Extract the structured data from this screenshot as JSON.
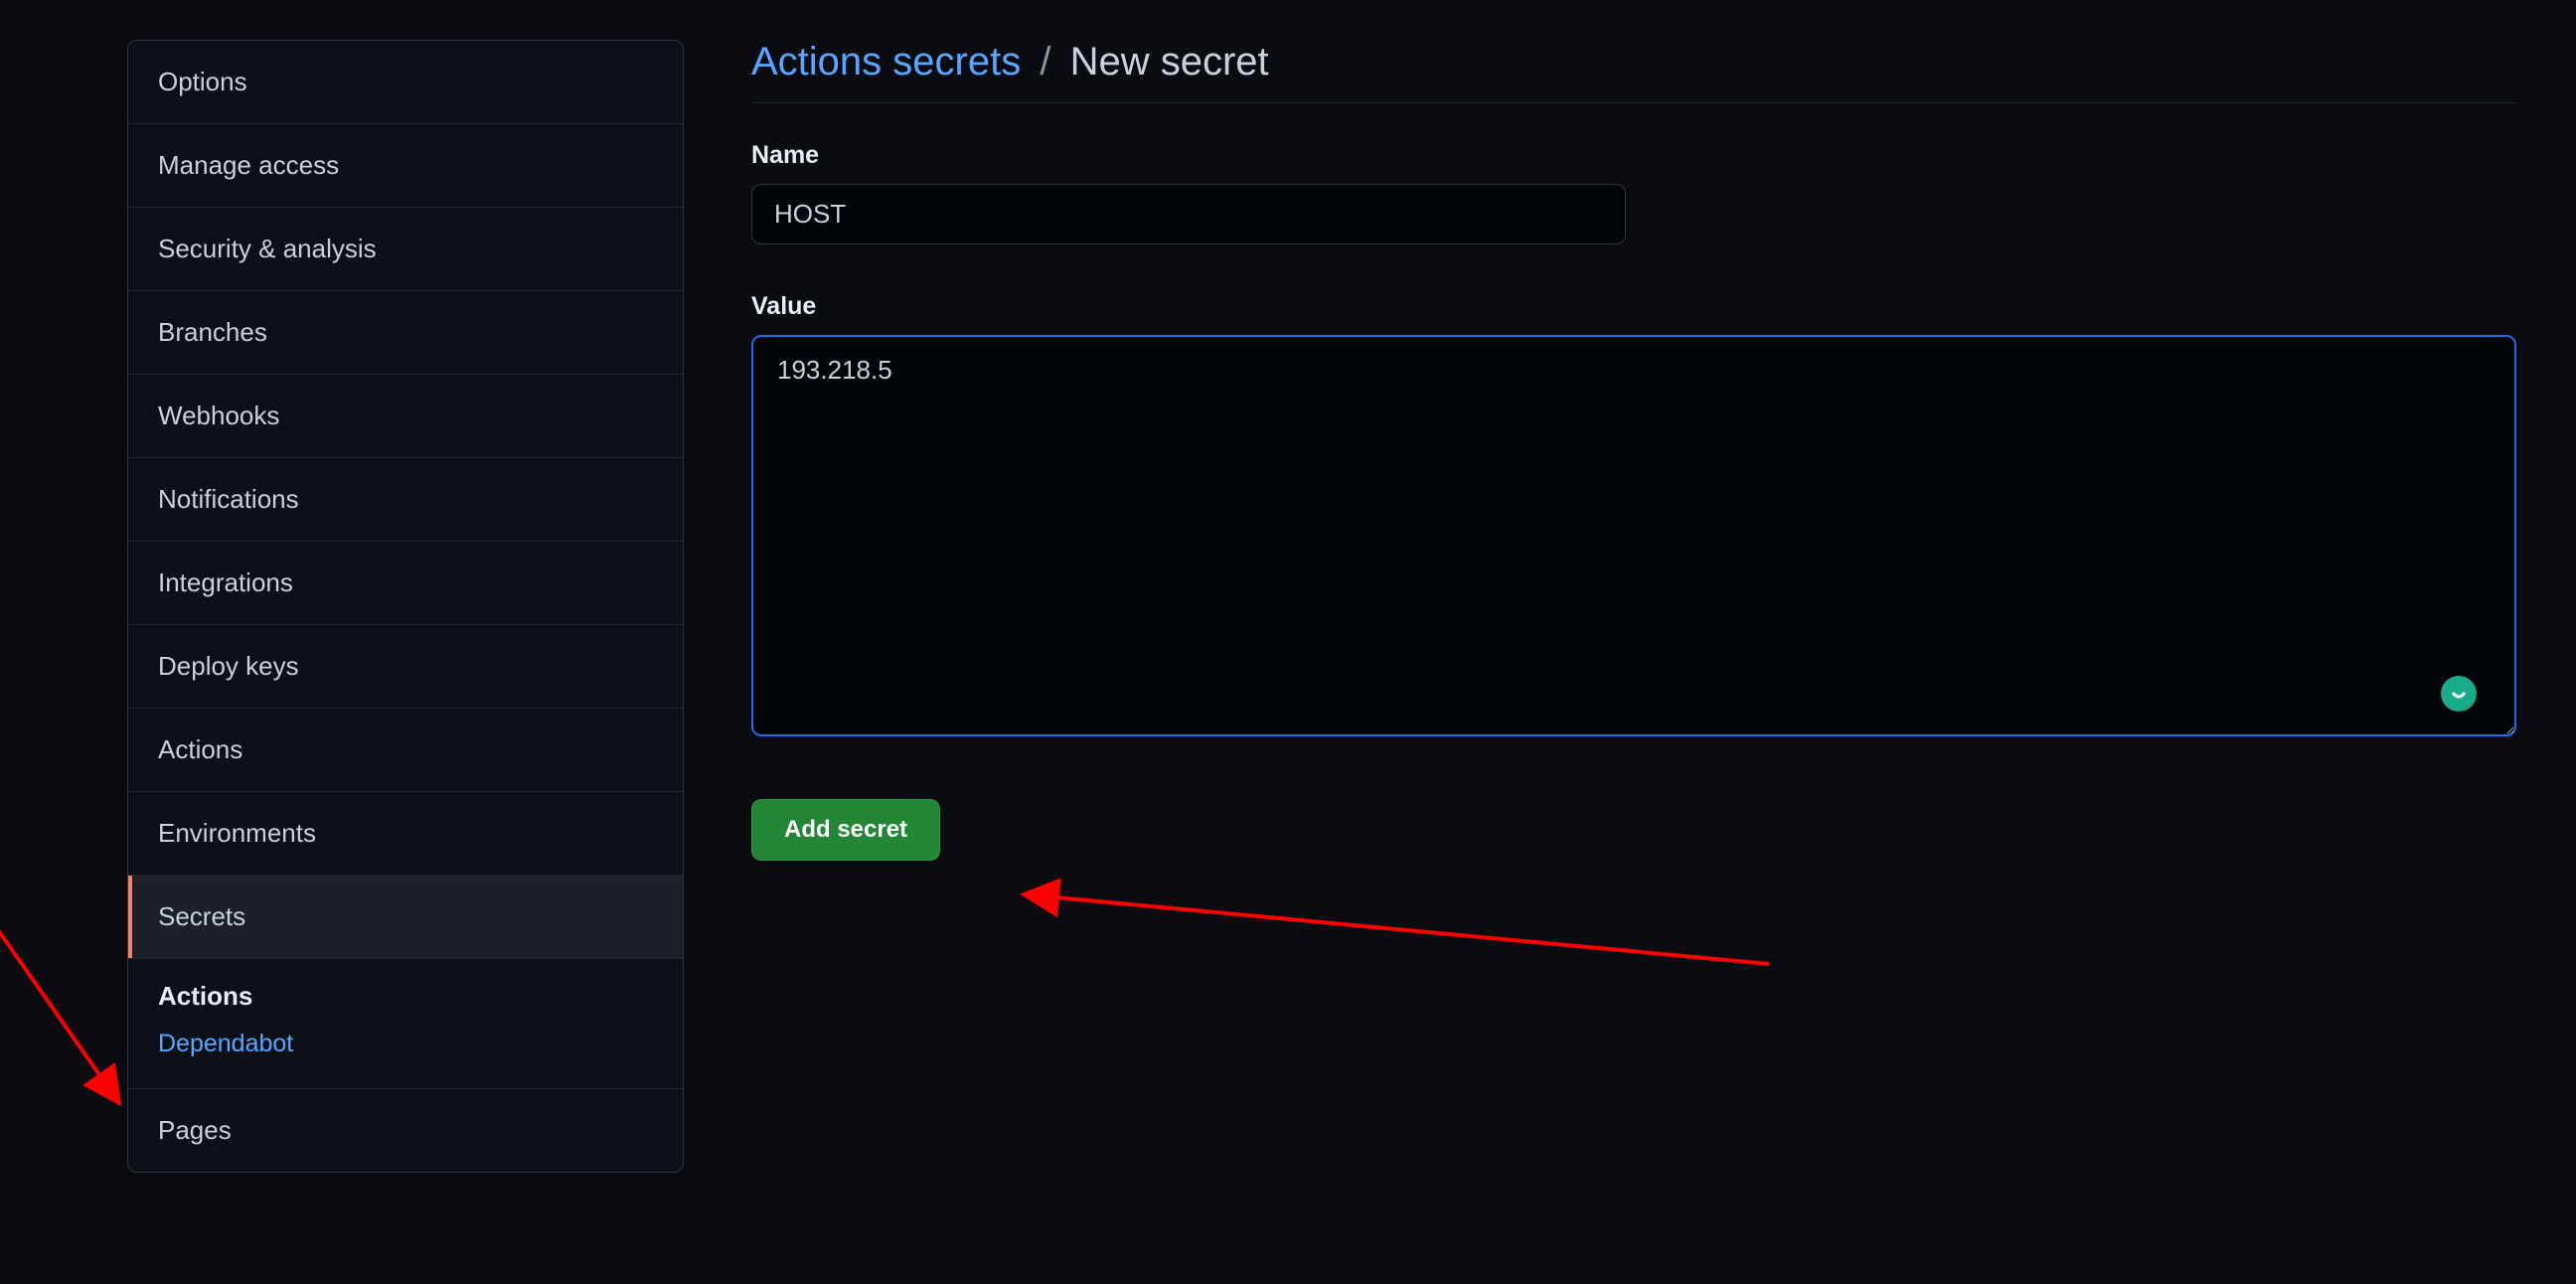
{
  "sidebar": {
    "items": [
      {
        "label": "Options"
      },
      {
        "label": "Manage access"
      },
      {
        "label": "Security & analysis"
      },
      {
        "label": "Branches"
      },
      {
        "label": "Webhooks"
      },
      {
        "label": "Notifications"
      },
      {
        "label": "Integrations"
      },
      {
        "label": "Deploy keys"
      },
      {
        "label": "Actions"
      },
      {
        "label": "Environments"
      },
      {
        "label": "Secrets"
      }
    ],
    "sub_heading": "Actions",
    "sub_items": [
      {
        "label": "Dependabot"
      }
    ],
    "trailing": [
      {
        "label": "Pages"
      }
    ]
  },
  "breadcrumb": {
    "link_label": "Actions secrets",
    "separator": "/",
    "current_label": "New secret"
  },
  "form": {
    "name_label": "Name",
    "name_value": "HOST",
    "value_label": "Value",
    "value_value": "193.218.5",
    "submit_label": "Add secret"
  }
}
